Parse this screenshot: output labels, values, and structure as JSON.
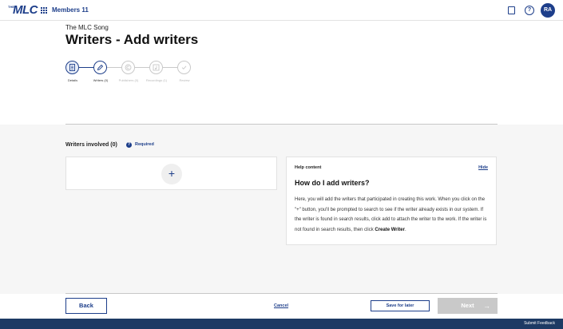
{
  "app": {
    "logo_the": "THE",
    "logo_mlc": "MLC",
    "name": "Members 11",
    "avatar_initials": "RA"
  },
  "page": {
    "subtitle": "The MLC Song",
    "title": "Writers - Add writers"
  },
  "stepper": {
    "steps": [
      {
        "label": "Details",
        "state": "done",
        "icon": "document-icon"
      },
      {
        "label": "Writers (0)",
        "state": "current",
        "icon": "pencil-icon"
      },
      {
        "label": "Publishers (0)",
        "state": "pending",
        "icon": "copyright-icon"
      },
      {
        "label": "Recordings (1)",
        "state": "pending",
        "icon": "music-note-icon"
      },
      {
        "label": "Review",
        "state": "pending",
        "icon": "check-icon"
      }
    ]
  },
  "writers": {
    "label": "Writers involved (0)",
    "info": "?",
    "required": "Required",
    "add_symbol": "+"
  },
  "help": {
    "heading": "Help content",
    "hide": "Hide",
    "title": "How do I add writers?",
    "text": "Here, you will add the writers that participated in creating this work. When you click on the \"+\" button, you'll be prompted to search to see if the writer already exists in our system. If the writer is found in search results, click add to attach the writer to the work. If the writer is not found in search results, then click",
    "text_bold": "Create Writer",
    "text_end": "."
  },
  "actions": {
    "back": "Back",
    "cancel": "Cancel",
    "save_later": "Save for later",
    "next": "Next",
    "next_arrow": "→"
  },
  "footer": {
    "feedback": "Submit Feedback"
  },
  "colors": {
    "brand": "#1d3e8a",
    "footer_bar": "#1d3a64",
    "disabled": "#c9c9c9",
    "canvas": "#f6f6f6"
  }
}
